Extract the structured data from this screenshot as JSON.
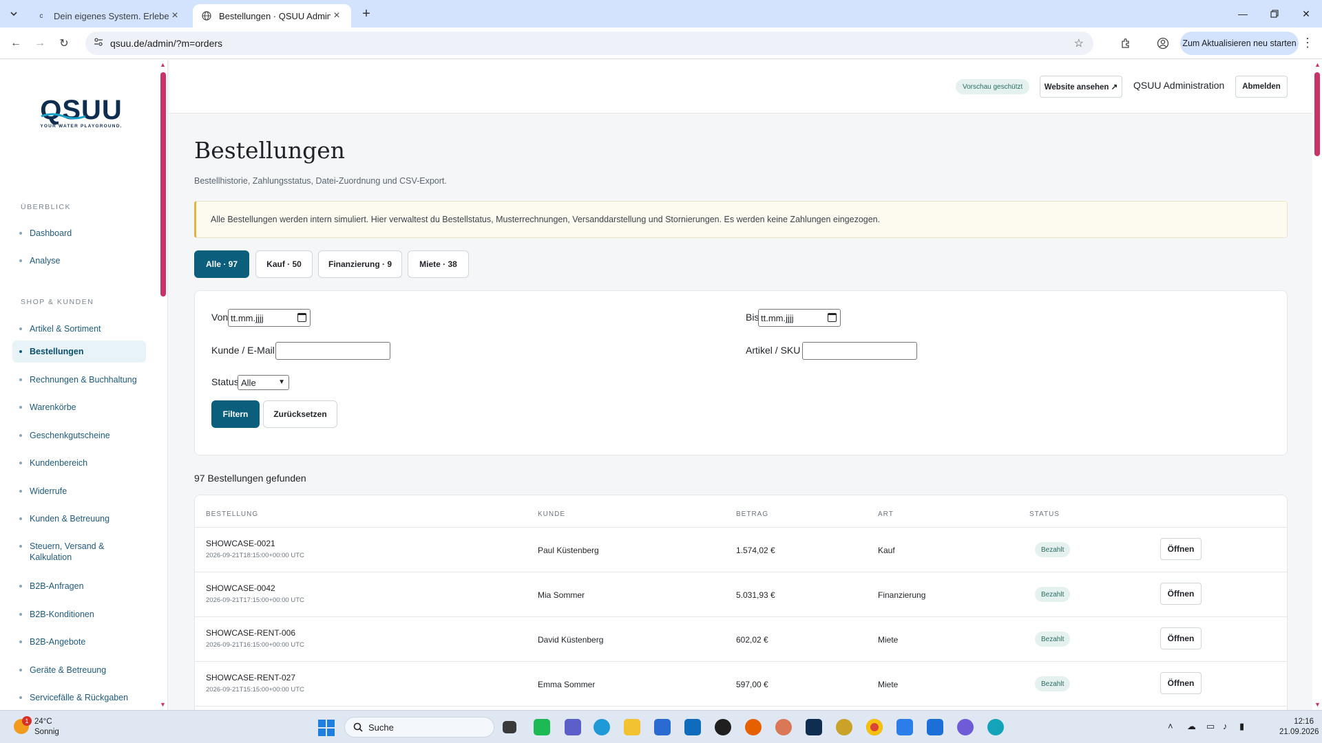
{
  "browser": {
    "tabs": [
      {
        "title": "Dein eigenes System. Erlebe, was",
        "favicon": "c"
      },
      {
        "title": "Bestellungen · QSUU Admin",
        "favicon": "globe"
      }
    ],
    "url": "qsuu.de/admin/?m=orders",
    "update_button": "Zum Aktualisieren neu starten"
  },
  "brand": {
    "logo_text": "QSUU",
    "tagline": "YOUR WATER PLAYGROUND.",
    "primary_color": "#0b5f7c",
    "accent_color": "#c8336a"
  },
  "sidebar": {
    "sections": [
      {
        "title": "ÜBERBLICK",
        "items": [
          "Dashboard",
          "Analyse"
        ]
      },
      {
        "title": "SHOP & KUNDEN",
        "items": [
          "Artikel & Sortiment",
          "Bestellungen",
          "Rechnungen & Buchhaltung",
          "Warenkörbe",
          "Geschenkgutscheine",
          "Kundenbereich",
          "Widerrufe",
          "Kunden & Betreuung",
          "Steuern, Versand & Kalkulation",
          "B2B-Anfragen",
          "B2B-Konditionen",
          "B2B-Angebote",
          "Geräte & Betreuung",
          "Servicefälle & Rückgaben"
        ]
      }
    ],
    "active_item": "Bestellungen"
  },
  "topbar": {
    "preview_badge": "Vorschau geschützt",
    "website_button": "Website ansehen ↗",
    "admin_label": "QSUU Administration",
    "logout_button": "Abmelden"
  },
  "page": {
    "title": "Bestellungen",
    "subtitle": "Bestellhistorie, Zahlungsstatus, Datei-Zuordnung und CSV-Export.",
    "notice": "Alle Bestellungen werden intern simuliert. Hier verwaltest du Bestellstatus, Musterrechnungen, Versanddarstellung und Stornierungen. Es werden keine Zahlungen eingezogen."
  },
  "filter_tabs": [
    {
      "label": "Alle · 97",
      "active": true
    },
    {
      "label": "Kauf · 50",
      "active": false
    },
    {
      "label": "Finanzierung · 9",
      "active": false
    },
    {
      "label": "Miete · 38",
      "active": false
    }
  ],
  "filters": {
    "from_label": "Von",
    "from_placeholder": "tt.mm.jjjj",
    "to_label": "Bis",
    "to_placeholder": "tt.mm.jjjj",
    "customer_label": "Kunde / E-Mail",
    "customer_value": "",
    "article_label": "Artikel / SKU",
    "article_value": "",
    "status_label": "Status",
    "status_value": "Alle",
    "filter_button": "Filtern",
    "reset_button": "Zurücksetzen"
  },
  "results": {
    "count_text": "97 Bestellungen gefunden",
    "columns": [
      "BESTELLUNG",
      "KUNDE",
      "BETRAG",
      "ART",
      "STATUS"
    ],
    "open_label": "Öffnen",
    "rows": [
      {
        "id": "SHOWCASE-0021",
        "timestamp": "2026-09-21T18:15:00+00:00 UTC",
        "customer": "Paul Küstenberg",
        "amount": "1.574,02 €",
        "type": "Kauf",
        "status": "Bezahlt"
      },
      {
        "id": "SHOWCASE-0042",
        "timestamp": "2026-09-21T17:15:00+00:00 UTC",
        "customer": "Mia Sommer",
        "amount": "5.031,93 €",
        "type": "Finanzierung",
        "status": "Bezahlt"
      },
      {
        "id": "SHOWCASE-RENT-006",
        "timestamp": "2026-09-21T16:15:00+00:00 UTC",
        "customer": "David Küstenberg",
        "amount": "602,02 €",
        "type": "Miete",
        "status": "Bezahlt"
      },
      {
        "id": "SHOWCASE-RENT-027",
        "timestamp": "2026-09-21T15:15:00+00:00 UTC",
        "customer": "Emma Sommer",
        "amount": "597,00 €",
        "type": "Miete",
        "status": "Bezahlt"
      }
    ]
  },
  "taskbar": {
    "weather_temp": "24°C",
    "weather_desc": "Sonnig",
    "weather_badge": "1",
    "search_label": "Suche",
    "time": "12:16",
    "date": "21.09.2026"
  }
}
